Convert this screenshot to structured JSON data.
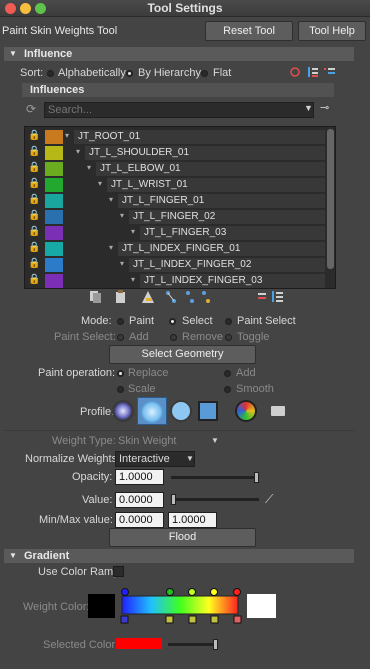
{
  "window": {
    "title": "Tool Settings"
  },
  "tool": {
    "name": "Paint Skin Weights Tool",
    "reset": "Reset Tool",
    "help": "Tool Help"
  },
  "influence": {
    "header": "Influence",
    "sort_label": "Sort:",
    "sort_options": [
      "Alphabetically",
      "By Hierarchy",
      "Flat"
    ],
    "sort_selected": "By Hierarchy",
    "sub_header": "Influences",
    "search_placeholder": "Search...",
    "joints": [
      {
        "name": "JT_ROOT_01",
        "color": "#c97a1e",
        "depth": 0
      },
      {
        "name": "JT_L_SHOULDER_01",
        "color": "#b5b817",
        "depth": 1
      },
      {
        "name": "JT_L_ELBOW_01",
        "color": "#6bab20",
        "depth": 2
      },
      {
        "name": "JT_L_WRIST_01",
        "color": "#22a82e",
        "depth": 3
      },
      {
        "name": "JT_L_FINGER_01",
        "color": "#1aa69e",
        "depth": 4
      },
      {
        "name": "JT_L_FINGER_02",
        "color": "#2a6fae",
        "depth": 5
      },
      {
        "name": "JT_L_FINGER_03",
        "color": "#7a2fb4",
        "depth": 6
      },
      {
        "name": "JT_L_INDEX_FINGER_01",
        "color": "#16a9a5",
        "depth": 4
      },
      {
        "name": "JT_L_INDEX_FINGER_02",
        "color": "#2c7bc8",
        "depth": 5
      },
      {
        "name": "JT_L_INDEX_FINGER_03",
        "color": "#7c2fb6",
        "depth": 6
      }
    ]
  },
  "paint": {
    "mode_label": "Mode:",
    "mode_options": [
      "Paint",
      "Select",
      "Paint Select"
    ],
    "mode_selected": "Select",
    "paint_select_label": "Paint Select:",
    "paint_select_options": [
      "Add",
      "Remove",
      "Toggle"
    ],
    "select_geometry": "Select Geometry",
    "operation_label": "Paint operation:",
    "operation_options": [
      "Replace",
      "Add",
      "Scale",
      "Smooth"
    ],
    "operation_selected": "Replace",
    "profile_label": "Profile:",
    "weight_type_label": "Weight Type:",
    "weight_type_value": "Skin Weight",
    "normalize_label": "Normalize Weights:",
    "normalize_value": "Interactive",
    "opacity_label": "Opacity:",
    "opacity_value": "1.0000",
    "opacity_level": 1.0,
    "value_label": "Value:",
    "value_value": "0.0000",
    "value_level": 0.0,
    "minmax_label": "Min/Max value:",
    "min_value": "0.0000",
    "max_value": "1.0000",
    "flood": "Flood"
  },
  "gradient": {
    "header": "Gradient",
    "use_ramp_label": "Use Color Ramp",
    "weight_color_label": "Weight Color:",
    "selected_color_label": "Selected Color:",
    "selected_color": "#ff0000"
  }
}
